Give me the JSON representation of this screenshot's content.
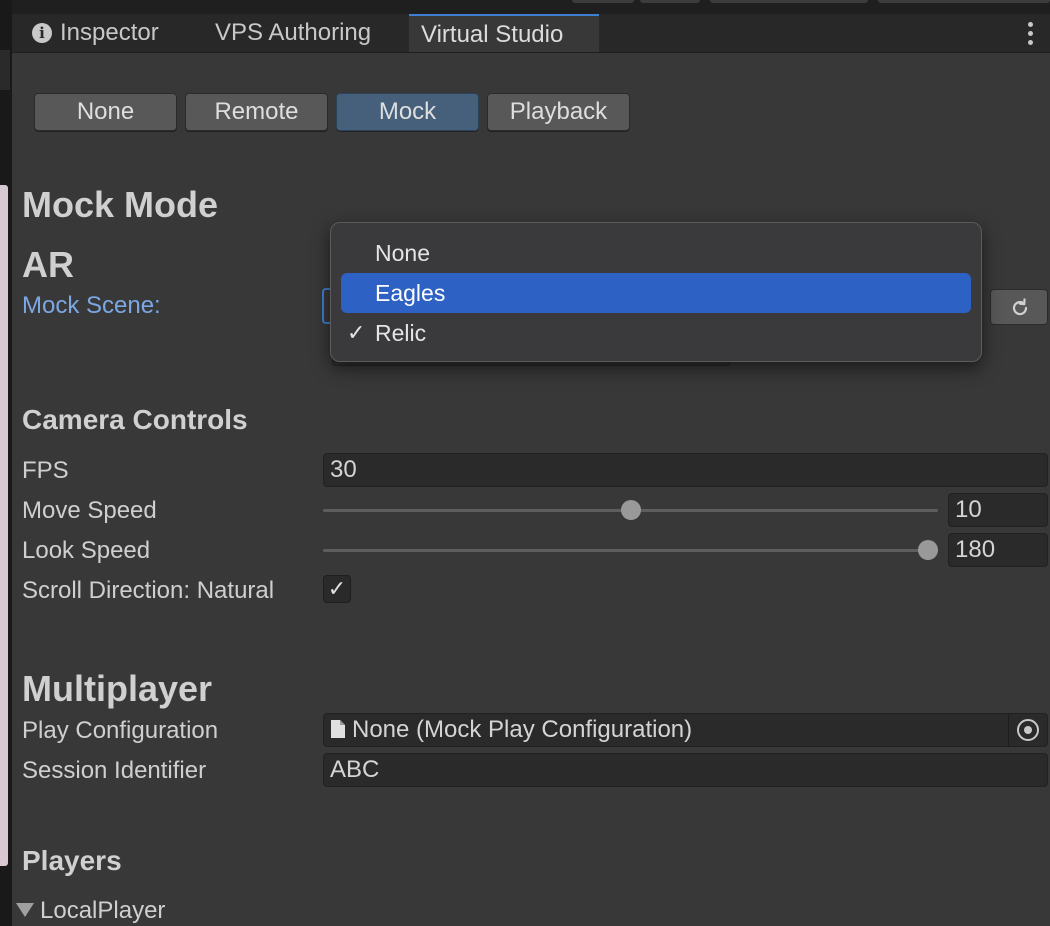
{
  "tabs": [
    {
      "label": "Inspector",
      "icon": "info-icon"
    },
    {
      "label": "VPS Authoring"
    },
    {
      "label": "Virtual Studio",
      "active": true
    }
  ],
  "modes": [
    {
      "label": "None"
    },
    {
      "label": "Remote"
    },
    {
      "label": "Mock",
      "active": true
    },
    {
      "label": "Playback"
    }
  ],
  "mock_mode": {
    "title": "Mock Mode",
    "ar_section": "AR",
    "mock_scene_label": "Mock Scene:",
    "scene_dropdown": {
      "options": [
        "None",
        "Eagles",
        "Relic"
      ],
      "highlighted": "Eagles",
      "checked": "Relic"
    }
  },
  "camera_controls": {
    "title": "Camera Controls",
    "fps_label": "FPS",
    "fps_value": "30",
    "move_speed_label": "Move Speed",
    "move_speed_value": "10",
    "move_speed_fraction": 0.5,
    "look_speed_label": "Look Speed",
    "look_speed_value": "180",
    "look_speed_fraction": 1.0,
    "scroll_label": "Scroll Direction: Natural",
    "scroll_checked": true
  },
  "multiplayer": {
    "title": "Multiplayer",
    "play_config_label": "Play Configuration",
    "play_config_value": "None (Mock Play Configuration)",
    "session_label": "Session Identifier",
    "session_value": "ABC"
  },
  "players": {
    "title": "Players",
    "local_player": "LocalPlayer"
  },
  "colors": {
    "accent": "#3d7fd0",
    "menu_highlight": "#2d61c4",
    "active_mode": "#46607c",
    "label_blue": "#7ba7e3"
  }
}
